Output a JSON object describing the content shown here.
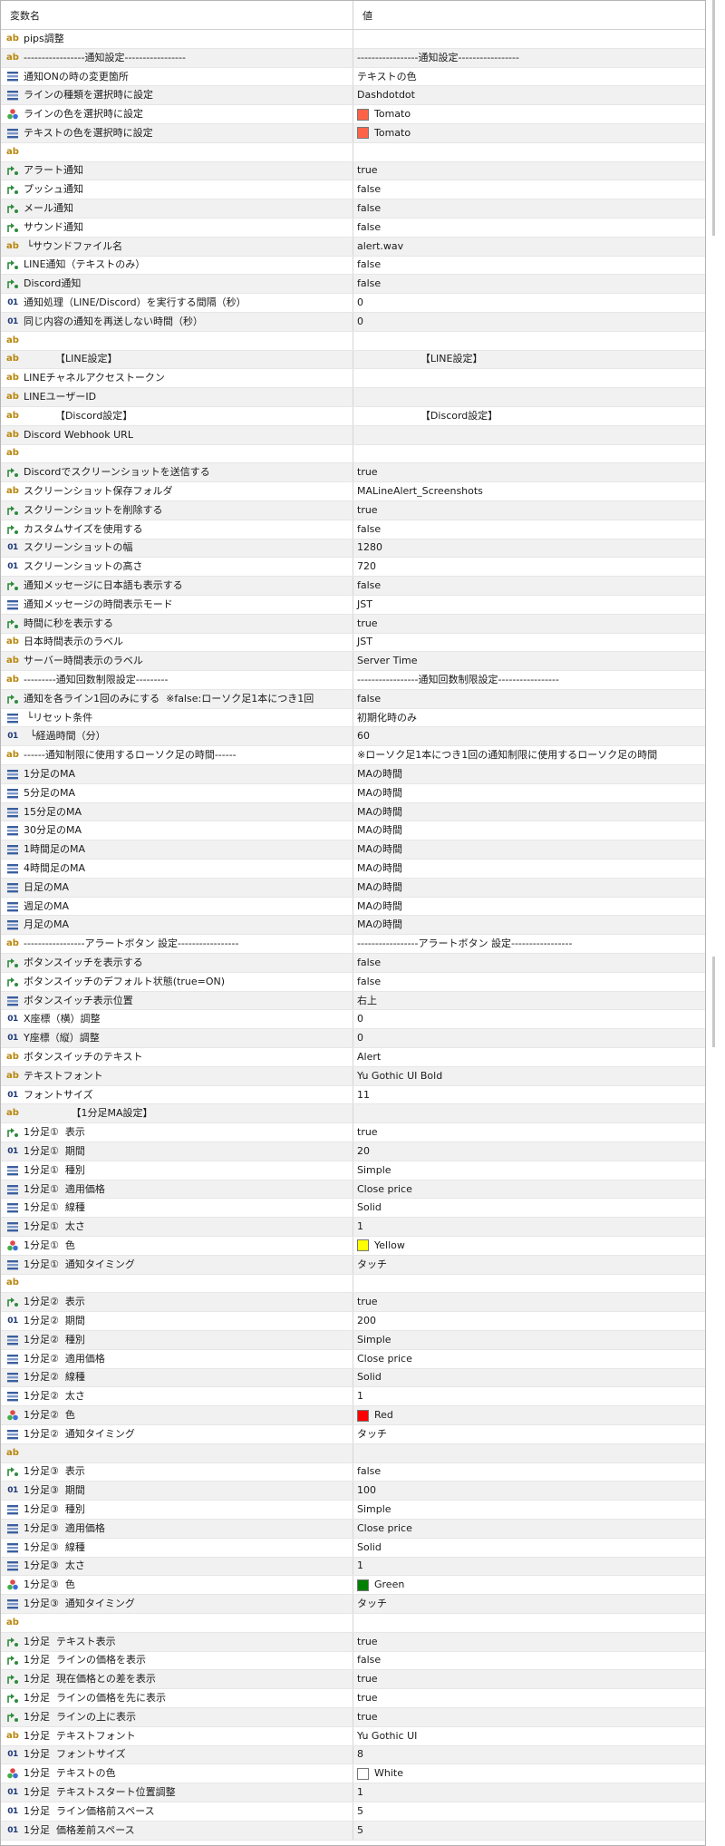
{
  "header": {
    "name": "変数名",
    "value": "値"
  },
  "rows": [
    {
      "icon": "ab-icon",
      "name": "pips調整",
      "value": ""
    },
    {
      "icon": "ab-icon",
      "name": "-----------------通知設定-----------------",
      "value": "-----------------通知設定-----------------"
    },
    {
      "icon": "list-icon",
      "name": "通知ONの時の変更箇所",
      "value": "テキストの色"
    },
    {
      "icon": "list-icon",
      "name": "ラインの種類を選択時に設定",
      "value": "Dashdotdot"
    },
    {
      "icon": "palette-icon",
      "name": "ラインの色を選択時に設定",
      "value": "Tomato",
      "swatch": "#ff6347"
    },
    {
      "icon": "list-icon",
      "name": "テキストの色を選択時に設定",
      "value": "Tomato",
      "swatch": "#ff6347"
    },
    {
      "icon": "ab-icon",
      "name": "",
      "value": ""
    },
    {
      "icon": "bool-icon",
      "name": "アラート通知",
      "value": "true"
    },
    {
      "icon": "bool-icon",
      "name": "プッシュ通知",
      "value": "false"
    },
    {
      "icon": "bool-icon",
      "name": "メール通知",
      "value": "false"
    },
    {
      "icon": "bool-icon",
      "name": "サウンド通知",
      "value": "false"
    },
    {
      "icon": "ab-icon",
      "name": " └サウンドファイル名",
      "value": "alert.wav"
    },
    {
      "icon": "bool-icon",
      "name": "LINE通知（テキストのみ）",
      "value": "false"
    },
    {
      "icon": "bool-icon",
      "name": "Discord通知",
      "value": "false"
    },
    {
      "icon": "num-icon",
      "name": "通知処理（LINE/Discord）を実行する間隔（秒）",
      "value": "0"
    },
    {
      "icon": "num-icon",
      "name": "同じ内容の通知を再送しない時間（秒）",
      "value": "0"
    },
    {
      "icon": "ab-icon",
      "name": "",
      "value": ""
    },
    {
      "icon": "ab-icon",
      "name": "          【LINE設定】",
      "value": "                    【LINE設定】"
    },
    {
      "icon": "ab-icon",
      "name": "LINEチャネルアクセストークン",
      "value": ""
    },
    {
      "icon": "ab-icon",
      "name": "LINEユーザーID",
      "value": ""
    },
    {
      "icon": "ab-icon",
      "name": "          【Discord設定】",
      "value": "                    【Discord設定】"
    },
    {
      "icon": "ab-icon",
      "name": "Discord Webhook URL",
      "value": ""
    },
    {
      "icon": "ab-icon",
      "name": "",
      "value": ""
    },
    {
      "icon": "bool-icon",
      "name": "Discordでスクリーンショットを送信する",
      "value": "true"
    },
    {
      "icon": "ab-icon",
      "name": "スクリーンショット保存フォルダ",
      "value": "MALineAlert_Screenshots"
    },
    {
      "icon": "bool-icon",
      "name": "スクリーンショットを削除する",
      "value": "true"
    },
    {
      "icon": "bool-icon",
      "name": "カスタムサイズを使用する",
      "value": "false"
    },
    {
      "icon": "num-icon",
      "name": "スクリーンショットの幅",
      "value": "1280"
    },
    {
      "icon": "num-icon",
      "name": "スクリーンショットの高さ",
      "value": "720"
    },
    {
      "icon": "bool-icon",
      "name": "通知メッセージに日本語も表示する",
      "value": "false"
    },
    {
      "icon": "list-icon",
      "name": "通知メッセージの時間表示モード",
      "value": "JST"
    },
    {
      "icon": "bool-icon",
      "name": "時間に秒を表示する",
      "value": "true"
    },
    {
      "icon": "ab-icon",
      "name": "日本時間表示のラベル",
      "value": "JST"
    },
    {
      "icon": "ab-icon",
      "name": "サーバー時間表示のラベル",
      "value": "Server Time"
    },
    {
      "icon": "ab-icon",
      "name": "---------通知回数制限設定---------",
      "value": "-----------------通知回数制限設定-----------------"
    },
    {
      "icon": "bool-icon",
      "name": "通知を各ライン1回のみにする  ※false:ローソク足1本につき1回",
      "value": "false"
    },
    {
      "icon": "list-icon",
      "name": " └リセット条件",
      "value": "初期化時のみ"
    },
    {
      "icon": "num-icon",
      "name": "  └経過時間（分）",
      "value": "60"
    },
    {
      "icon": "ab-icon",
      "name": "------通知制限に使用するローソク足の時間------",
      "value": "※ローソク足1本につき1回の通知制限に使用するローソク足の時間"
    },
    {
      "icon": "list-icon",
      "name": "1分足のMA",
      "value": "MAの時間"
    },
    {
      "icon": "list-icon",
      "name": "5分足のMA",
      "value": "MAの時間"
    },
    {
      "icon": "list-icon",
      "name": "15分足のMA",
      "value": "MAの時間"
    },
    {
      "icon": "list-icon",
      "name": "30分足のMA",
      "value": "MAの時間"
    },
    {
      "icon": "list-icon",
      "name": "1時間足のMA",
      "value": "MAの時間"
    },
    {
      "icon": "list-icon",
      "name": "4時間足のMA",
      "value": "MAの時間"
    },
    {
      "icon": "list-icon",
      "name": "日足のMA",
      "value": "MAの時間"
    },
    {
      "icon": "list-icon",
      "name": "週足のMA",
      "value": "MAの時間"
    },
    {
      "icon": "list-icon",
      "name": "月足のMA",
      "value": "MAの時間"
    },
    {
      "icon": "ab-icon",
      "name": "-----------------アラートボタン 設定-----------------",
      "value": "-----------------アラートボタン 設定-----------------"
    },
    {
      "icon": "bool-icon",
      "name": "ボタンスイッチを表示する",
      "value": "false"
    },
    {
      "icon": "bool-icon",
      "name": "ボタンスイッチのデフォルト状態(true=ON)",
      "value": "false"
    },
    {
      "icon": "list-icon",
      "name": "ボタンスイッチ表示位置",
      "value": "右上"
    },
    {
      "icon": "num-icon",
      "name": "X座標（横）調整",
      "value": "0"
    },
    {
      "icon": "num-icon",
      "name": "Y座標（縦）調整",
      "value": "0"
    },
    {
      "icon": "ab-icon",
      "name": "ボタンスイッチのテキスト",
      "value": "Alert"
    },
    {
      "icon": "ab-icon",
      "name": "テキストフォント",
      "value": "Yu Gothic UI Bold"
    },
    {
      "icon": "num-icon",
      "name": "フォントサイズ",
      "value": "11"
    },
    {
      "icon": "ab-icon",
      "name": "               【1分足MA設定】",
      "value": ""
    },
    {
      "icon": "bool-icon",
      "name": "1分足①  表示",
      "value": "true"
    },
    {
      "icon": "num-icon",
      "name": "1分足①  期間",
      "value": "20"
    },
    {
      "icon": "list-icon",
      "name": "1分足①  種別",
      "value": "Simple"
    },
    {
      "icon": "list-icon",
      "name": "1分足①  適用価格",
      "value": "Close price"
    },
    {
      "icon": "list-icon",
      "name": "1分足①  線種",
      "value": "Solid"
    },
    {
      "icon": "list-icon",
      "name": "1分足①  太さ",
      "value": "1"
    },
    {
      "icon": "palette-icon",
      "name": "1分足①  色",
      "value": "Yellow",
      "swatch": "#ffff00"
    },
    {
      "icon": "list-icon",
      "name": "1分足①  通知タイミング",
      "value": "タッチ"
    },
    {
      "icon": "ab-icon",
      "name": "",
      "value": ""
    },
    {
      "icon": "bool-icon",
      "name": "1分足②  表示",
      "value": "true"
    },
    {
      "icon": "num-icon",
      "name": "1分足②  期間",
      "value": "200"
    },
    {
      "icon": "list-icon",
      "name": "1分足②  種別",
      "value": "Simple"
    },
    {
      "icon": "list-icon",
      "name": "1分足②  適用価格",
      "value": "Close price"
    },
    {
      "icon": "list-icon",
      "name": "1分足②  線種",
      "value": "Solid"
    },
    {
      "icon": "list-icon",
      "name": "1分足②  太さ",
      "value": "1"
    },
    {
      "icon": "palette-icon",
      "name": "1分足②  色",
      "value": "Red",
      "swatch": "#ff0000"
    },
    {
      "icon": "list-icon",
      "name": "1分足②  通知タイミング",
      "value": "タッチ"
    },
    {
      "icon": "ab-icon",
      "name": "",
      "value": ""
    },
    {
      "icon": "bool-icon",
      "name": "1分足③  表示",
      "value": "false"
    },
    {
      "icon": "num-icon",
      "name": "1分足③  期間",
      "value": "100"
    },
    {
      "icon": "list-icon",
      "name": "1分足③  種別",
      "value": "Simple"
    },
    {
      "icon": "list-icon",
      "name": "1分足③  適用価格",
      "value": "Close price"
    },
    {
      "icon": "list-icon",
      "name": "1分足③  線種",
      "value": "Solid"
    },
    {
      "icon": "list-icon",
      "name": "1分足③  太さ",
      "value": "1"
    },
    {
      "icon": "palette-icon",
      "name": "1分足③  色",
      "value": "Green",
      "swatch": "#008000"
    },
    {
      "icon": "list-icon",
      "name": "1分足③  通知タイミング",
      "value": "タッチ"
    },
    {
      "icon": "ab-icon",
      "name": "",
      "value": ""
    },
    {
      "icon": "bool-icon",
      "name": "1分足  テキスト表示",
      "value": "true"
    },
    {
      "icon": "bool-icon",
      "name": "1分足  ラインの価格を表示",
      "value": "false"
    },
    {
      "icon": "bool-icon",
      "name": "1分足  現在価格との差を表示",
      "value": "true"
    },
    {
      "icon": "bool-icon",
      "name": "1分足  ラインの価格を先に表示",
      "value": "true"
    },
    {
      "icon": "bool-icon",
      "name": "1分足  ラインの上に表示",
      "value": "true"
    },
    {
      "icon": "ab-icon",
      "name": "1分足  テキストフォント",
      "value": "Yu Gothic UI"
    },
    {
      "icon": "num-icon",
      "name": "1分足  フォントサイズ",
      "value": "8"
    },
    {
      "icon": "palette-icon",
      "name": "1分足  テキストの色",
      "value": "White",
      "swatch": "#ffffff"
    },
    {
      "icon": "num-icon",
      "name": "1分足  テキストスタート位置調整",
      "value": "1"
    },
    {
      "icon": "num-icon",
      "name": "1分足  ライン価格前スペース",
      "value": "5"
    },
    {
      "icon": "num-icon",
      "name": "1分足  価格差前スペース",
      "value": "5"
    }
  ],
  "colors": {
    "row_alt": "#f1f1f1",
    "ab_icon": "#b8860b",
    "num_icon": "#1e3a78",
    "bool_icon": "#2e8b3d",
    "list_icon": "#3a5fa0"
  }
}
